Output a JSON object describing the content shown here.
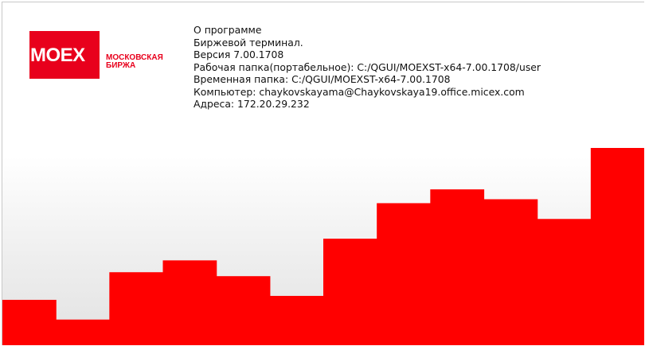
{
  "logo": {
    "mark": "MOEX",
    "wordmark_line1": "МОСКОВСКАЯ",
    "wordmark_line2": "БИРЖА"
  },
  "info": {
    "title": "О программе",
    "product": "Биржевой терминал.",
    "version": "Версия 7.00.1708",
    "work_folder": "Рабочая папка(портабельное): C:/QGUI/MOEXST-x64-7.00.1708/user",
    "temp_folder": "Временная папка: C:/QGUI/MOEXST-x64-7.00.1708",
    "computer": "Компьютер: chaykovskayama@Chaykovskaya19.office.micex.com",
    "addresses": "Адреса: 172.20.29.232"
  },
  "colors": {
    "brand_red": "#e8001c",
    "bars_red": "#ff0000"
  },
  "decor": {
    "bar_levels": [
      0.23,
      0.13,
      0.37,
      0.43,
      0.35,
      0.25,
      0.54,
      0.72,
      0.79,
      0.74,
      0.64,
      1.0
    ]
  }
}
